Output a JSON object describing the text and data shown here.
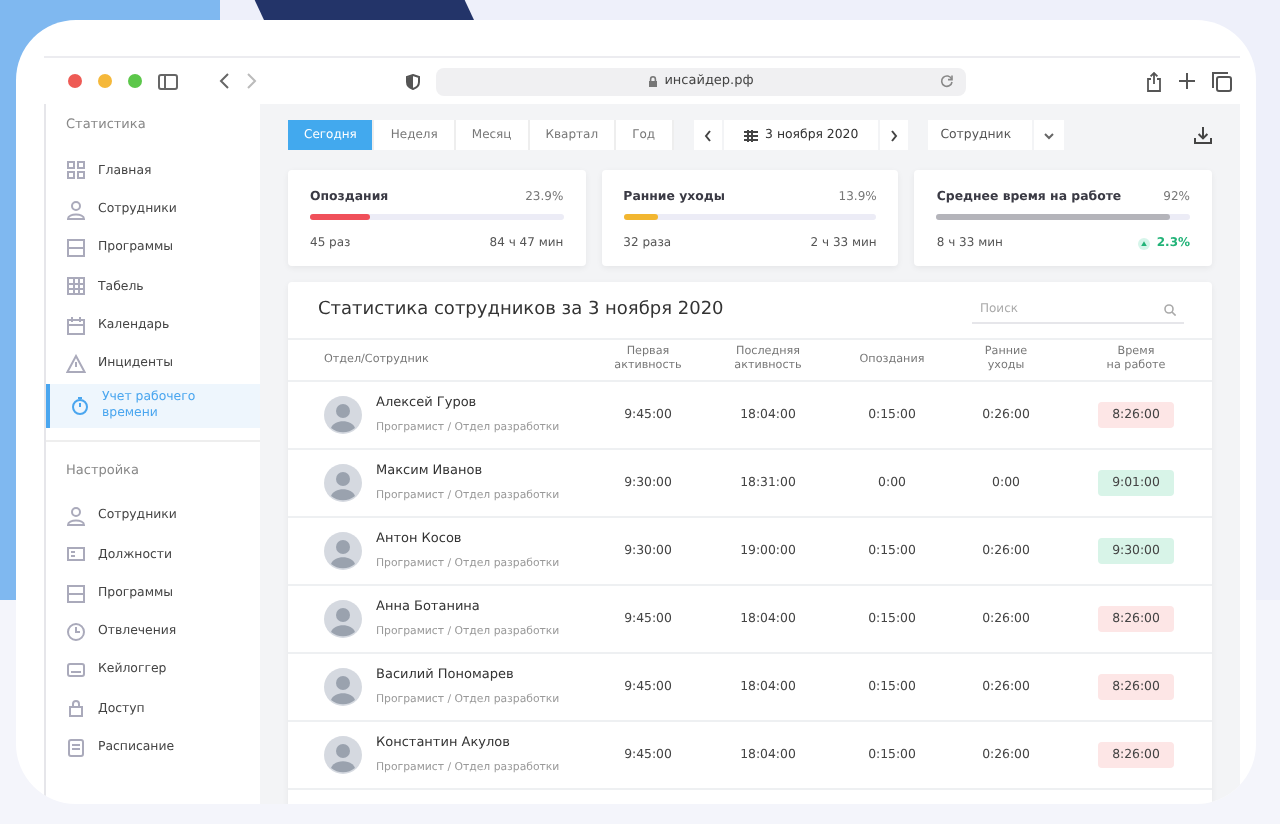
{
  "browser": {
    "url": "инсайдер.рф"
  },
  "sidebar": {
    "sections": [
      {
        "title": "Статистика",
        "items": [
          {
            "label": "Главная",
            "selected": false
          },
          {
            "label": "Сотрудники",
            "selected": false
          },
          {
            "label": "Программы",
            "selected": false
          },
          {
            "label": "Табель",
            "selected": false
          },
          {
            "label": "Календарь",
            "selected": false
          },
          {
            "label": "Инциденты",
            "selected": false
          },
          {
            "label": "Учет рабочего времени",
            "selected": true
          }
        ]
      },
      {
        "title": "Настройка",
        "items": [
          {
            "label": "Сотрудники",
            "selected": false
          },
          {
            "label": "Должности",
            "selected": false
          },
          {
            "label": "Программы",
            "selected": false
          },
          {
            "label": "Отвлечения",
            "selected": false
          },
          {
            "label": "Кейлоггер",
            "selected": false
          },
          {
            "label": "Доступ",
            "selected": false
          },
          {
            "label": "Расписание",
            "selected": false
          }
        ]
      }
    ]
  },
  "period_tabs": [
    {
      "label": "Сегодня",
      "selected": true
    },
    {
      "label": "Неделя",
      "selected": false
    },
    {
      "label": "Месяц",
      "selected": false
    },
    {
      "label": "Квартал",
      "selected": false
    },
    {
      "label": "Год",
      "selected": false
    }
  ],
  "date_picker": {
    "date": "3 ноября 2020"
  },
  "employee_filter": {
    "value": "Сотрудник"
  },
  "stat_cards": [
    {
      "title": "Опоздания",
      "percent": "23.9%",
      "level": 0.239,
      "color": "#f0505a",
      "count": "45 раз",
      "total": "84 ч 47 мин"
    },
    {
      "title": "Ранние уходы",
      "percent": "13.9%",
      "level": 0.139,
      "color": "#f2b630",
      "count": "32 раза",
      "total": "2 ч 33 мин"
    },
    {
      "title": "Среднее время на работе",
      "percent": "92%",
      "level": 0.92,
      "color": "#b4b4ba",
      "count": "8 ч 33 мин",
      "change": "2.3%"
    }
  ],
  "table": {
    "title": "Статистика сотрудников за 3 ноября 2020",
    "search": {
      "placeholder": "Поиск"
    },
    "columns": [
      "Отдел/Сотрудник",
      "Первая\nактивность",
      "Последняя\nактивность",
      "Опоздания",
      "Ранние\nуходы",
      "Время\nна работе"
    ],
    "rows": [
      {
        "name": "Алексей Гуров",
        "position": "Програмист / Отдел разработки",
        "first": "9:45:00",
        "last": "18:04:00",
        "late": "0:15:00",
        "early": "0:26:00",
        "worked": "8:26:00",
        "color": "#fde6e6"
      },
      {
        "name": "Максим Иванов",
        "position": "Програмист / Отдел разработки",
        "first": "9:30:00",
        "last": "18:31:00",
        "late": "0:00",
        "early": "0:00",
        "worked": "9:01:00",
        "color": "#d8f4e8"
      },
      {
        "name": "Антон Косов",
        "position": "Програмист / Отдел разработки",
        "first": "9:30:00",
        "last": "19:00:00",
        "late": "0:15:00",
        "early": "0:26:00",
        "worked": "9:30:00",
        "color": "#d8f4e8"
      },
      {
        "name": "Анна Ботанина",
        "position": "Програмист / Отдел разработки",
        "first": "9:45:00",
        "last": "18:04:00",
        "late": "0:15:00",
        "early": "0:26:00",
        "worked": "8:26:00",
        "color": "#fde6e6"
      },
      {
        "name": "Василий Пономарев",
        "position": "Програмист / Отдел разработки",
        "first": "9:45:00",
        "last": "18:04:00",
        "late": "0:15:00",
        "early": "0:26:00",
        "worked": "8:26:00",
        "color": "#fde6e6"
      },
      {
        "name": "Константин Акулов",
        "position": "Програмист / Отдел разработки",
        "first": "9:45:00",
        "last": "18:04:00",
        "late": "0:15:00",
        "early": "0:26:00",
        "worked": "8:26:00",
        "color": "#fde6e6"
      }
    ]
  }
}
